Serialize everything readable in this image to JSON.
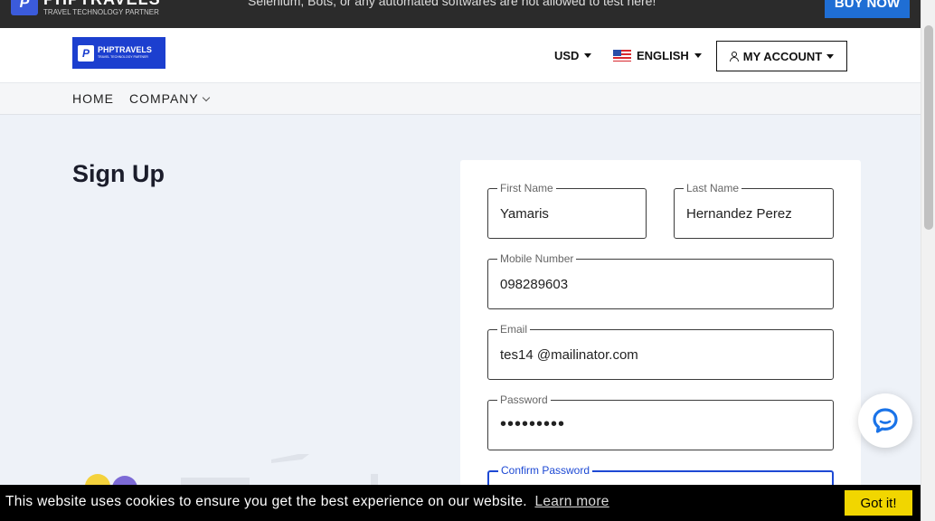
{
  "promo": {
    "brand": "PHPTRAVELS",
    "brand_tagline": "TRAVEL TECHNOLOGY PARTNER",
    "message": "Selenium, Bots, or any automated softwares are not allowed to test here!",
    "buy_now": "BUY NOW"
  },
  "header": {
    "logo_title": "PHPTRAVELS",
    "logo_tagline": "TRAVEL TECHNOLOGY PARTNER",
    "currency": "USD",
    "language": "ENGLISH",
    "account": "MY ACCOUNT"
  },
  "nav": {
    "items": [
      {
        "label": "HOME"
      },
      {
        "label": "COMPANY"
      }
    ]
  },
  "page": {
    "title": "Sign Up"
  },
  "form": {
    "first_name": {
      "label": "First Name",
      "value": "Yamaris"
    },
    "last_name": {
      "label": "Last Name",
      "value": "Hernandez Perez"
    },
    "mobile": {
      "label": "Mobile Number",
      "value": "098289603"
    },
    "email": {
      "label": "Email",
      "value": "tes14 @mailinator.com"
    },
    "password": {
      "label": "Password",
      "value": "•••••••••"
    },
    "confirm_password": {
      "label": "Confirm Password",
      "value": ""
    }
  },
  "cookie": {
    "message": "This website uses cookies to ensure you get the best experience on our website.",
    "link": "Learn more",
    "button": "Got it!"
  },
  "colors": {
    "accent": "#1d49d4",
    "brand": "#1c3fcf",
    "cookie_button": "#f1d600"
  }
}
